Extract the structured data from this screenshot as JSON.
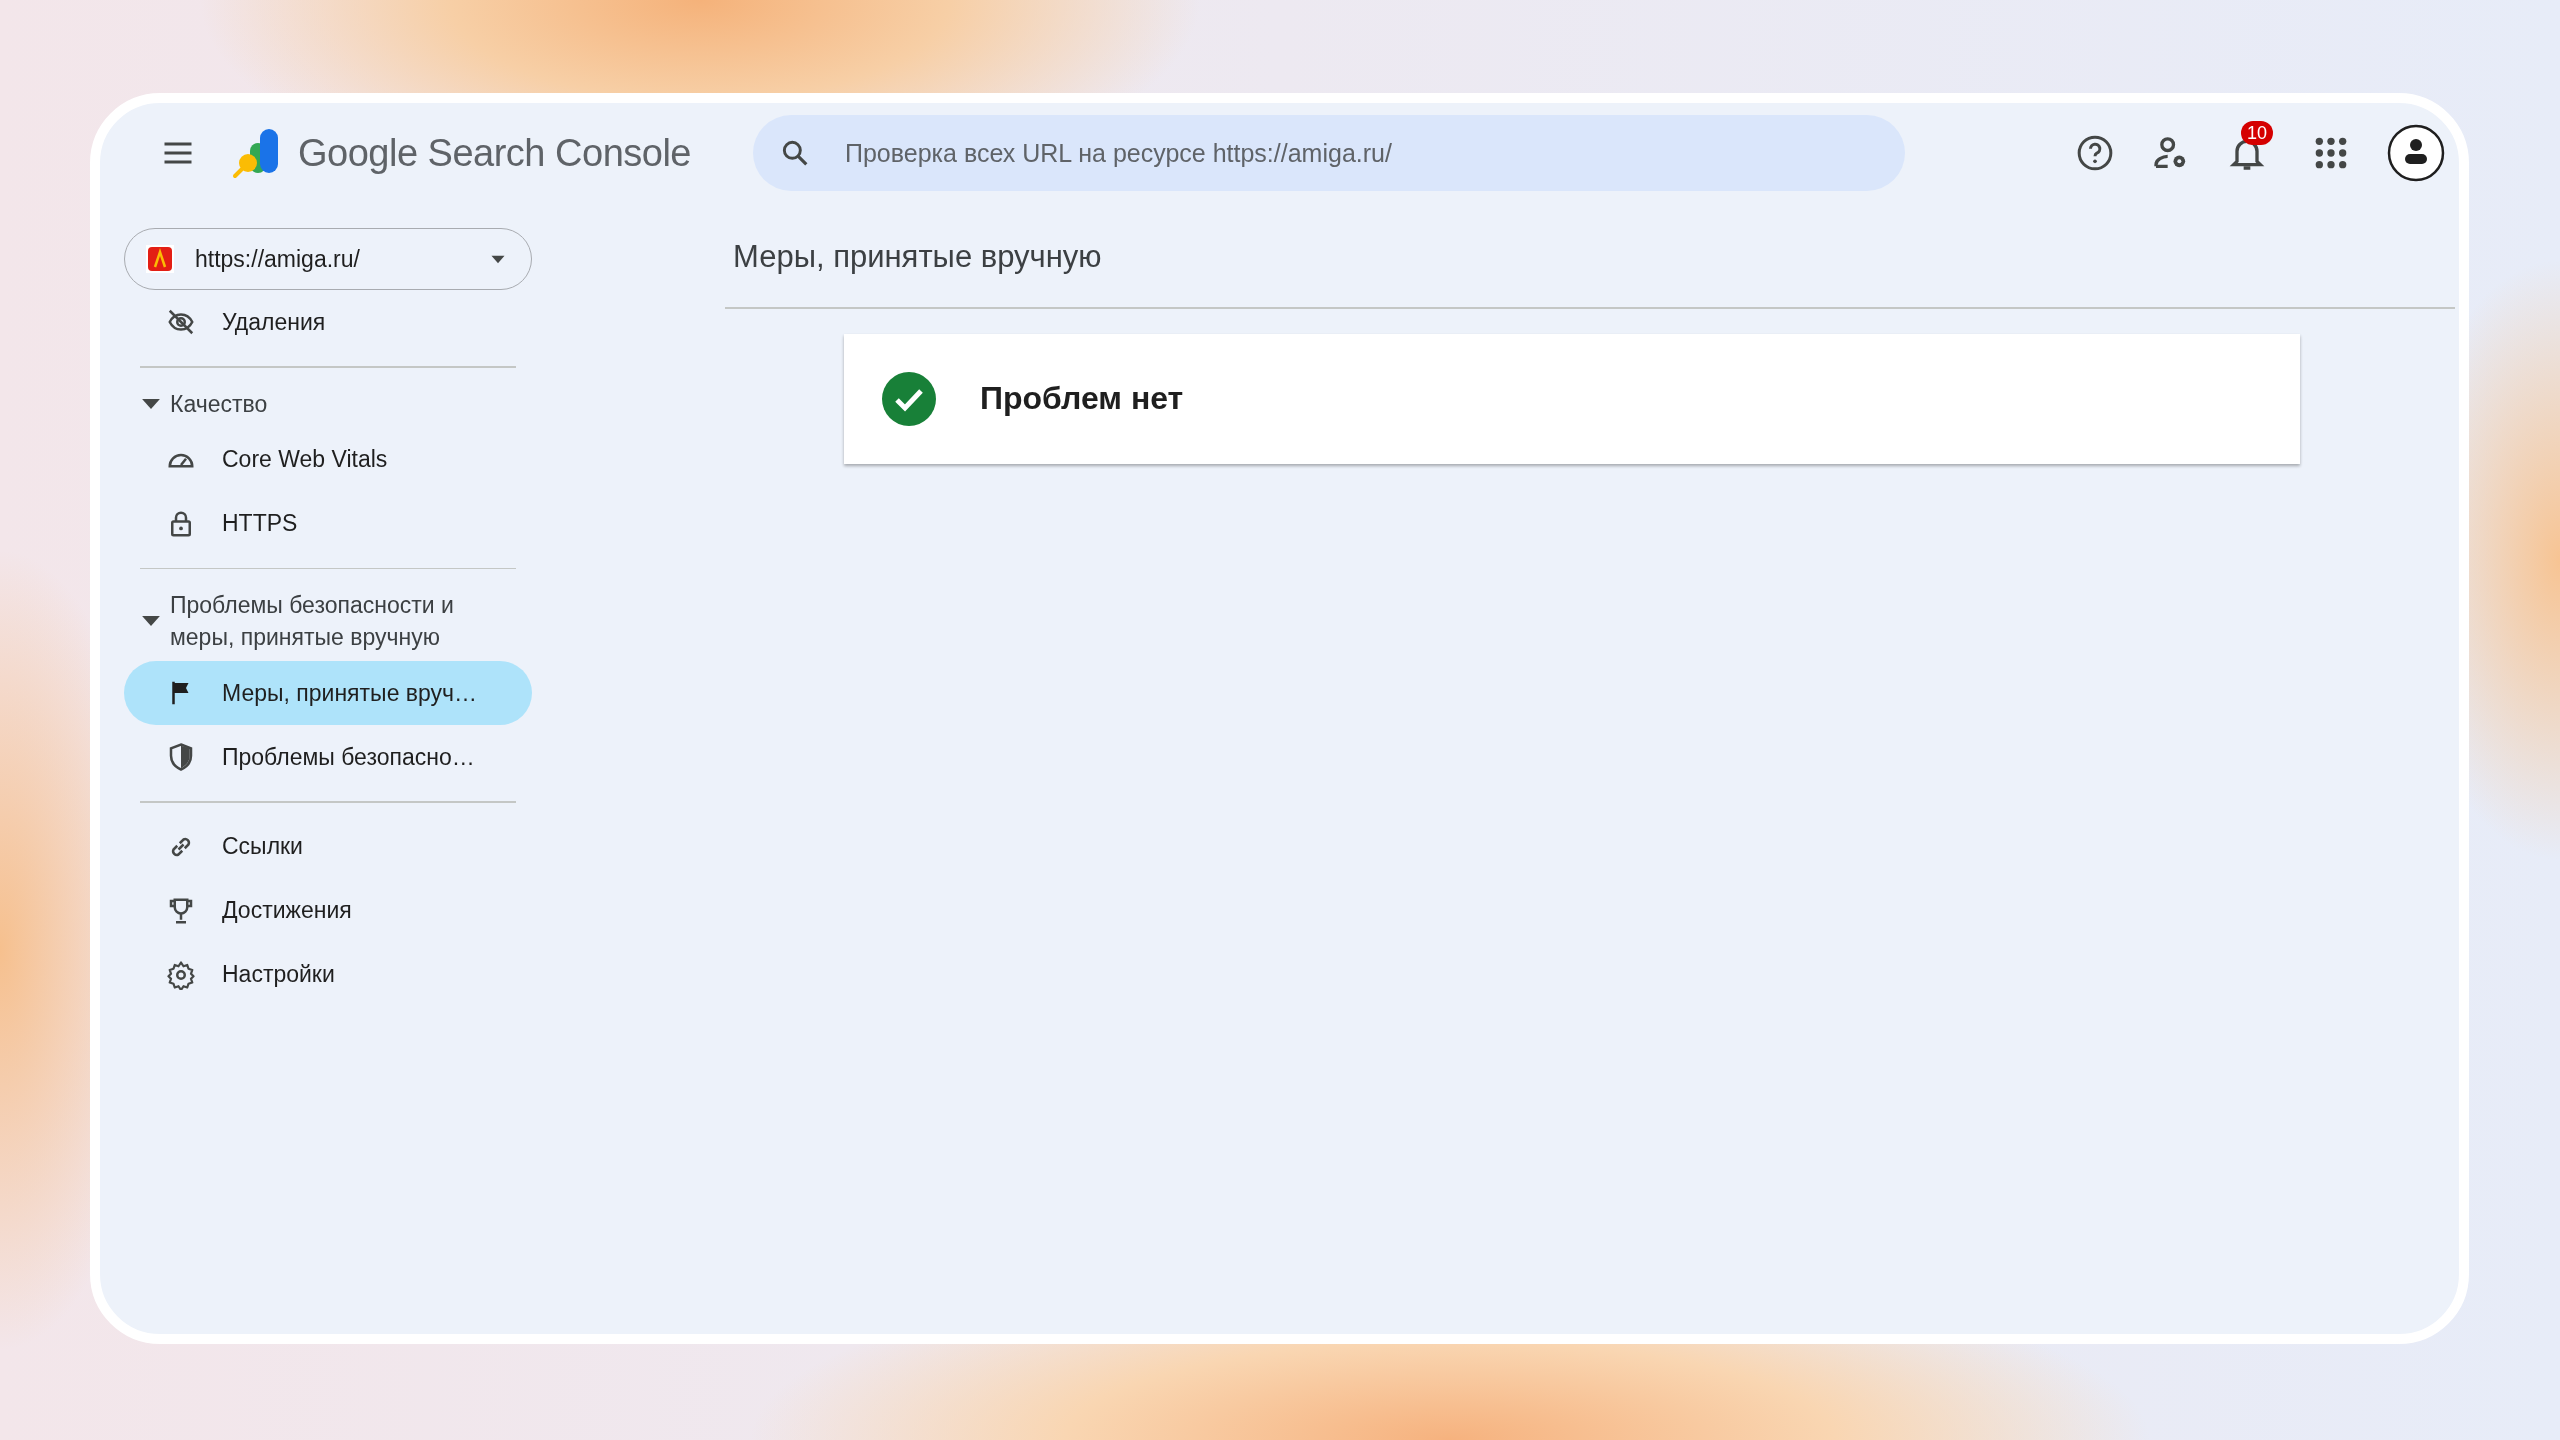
{
  "header": {
    "product_name": "Google Search Console",
    "search": {
      "placeholder": "Проверка всех URL на ресурсе https://amiga.ru/"
    },
    "notifications": {
      "badge": "10"
    }
  },
  "sidebar": {
    "property": "https://amiga.ru/",
    "sections": [
      {
        "items": [
          {
            "label": "Удаления",
            "selected": false
          }
        ]
      },
      {
        "heading": "Качество",
        "expanded": true,
        "items": [
          {
            "label": "Core Web Vitals",
            "selected": false
          },
          {
            "label": "HTTPS",
            "selected": false
          }
        ]
      },
      {
        "heading": "Проблемы безопасности и меры, принятые вручную",
        "expanded": true,
        "items": [
          {
            "label": "Меры, принятые вруч…",
            "selected": true
          },
          {
            "label": "Проблемы безопасно…",
            "selected": false
          }
        ]
      },
      {
        "items": [
          {
            "label": "Ссылки",
            "selected": false
          },
          {
            "label": "Достижения",
            "selected": false
          },
          {
            "label": "Настройки",
            "selected": false
          }
        ]
      }
    ]
  },
  "page": {
    "title": "Меры, принятые вручную",
    "status": {
      "kind": "ok",
      "text": "Проблем нет"
    }
  }
}
